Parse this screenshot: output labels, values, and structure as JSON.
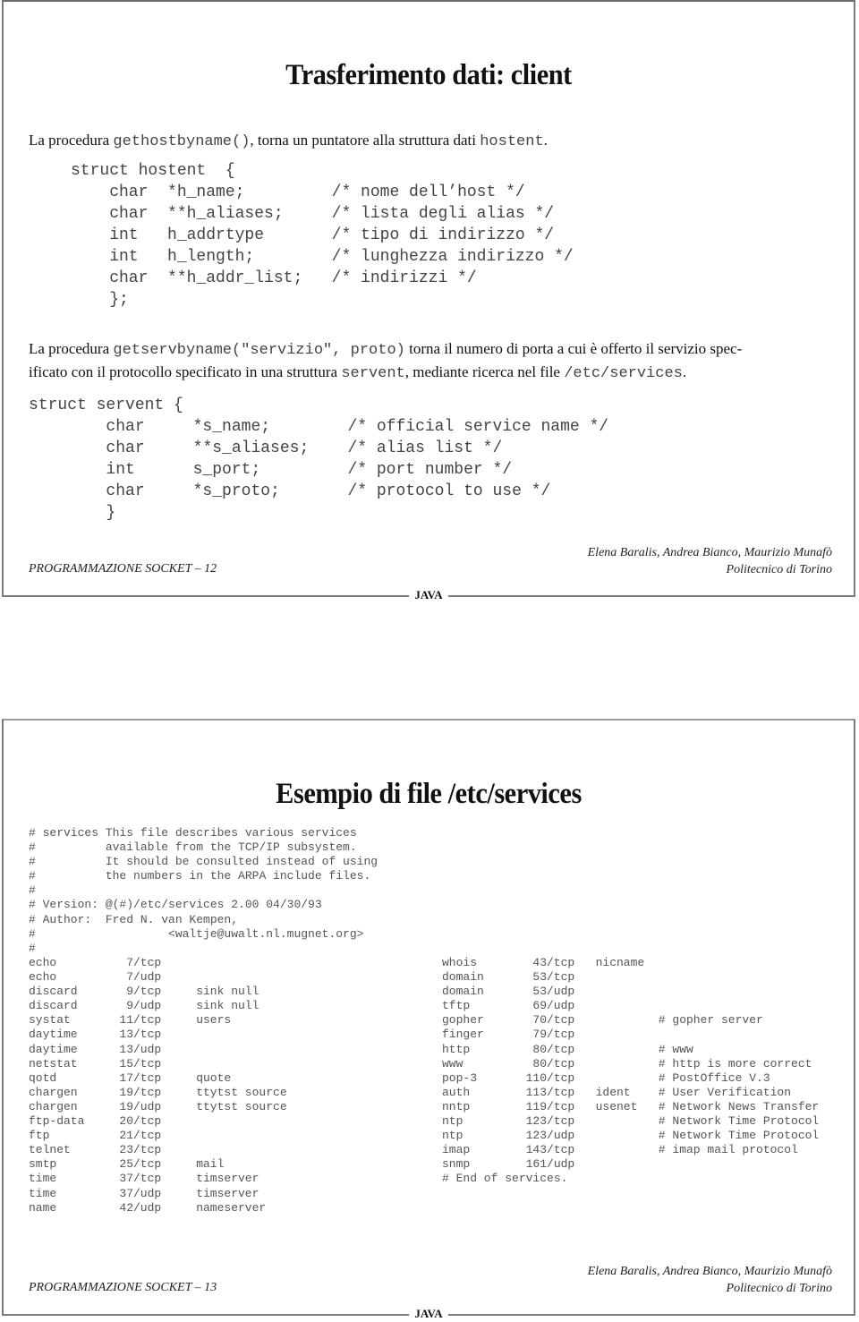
{
  "slides": [
    {
      "title": "Trasferimento dati: client",
      "intro": {
        "prefix": "La procedura ",
        "code1": "gethostbyname()",
        "middle": ", torna un puntatore alla struttura dati ",
        "code2": "hostent",
        "suffix": "."
      },
      "hostent_code": [
        "struct hostent  {",
        "    char  *h_name;         /* nome dell’host */",
        "    char  **h_aliases;     /* lista degli alias */",
        "    int   h_addrtype       /* tipo di indirizzo */",
        "    int   h_length;        /* lunghezza indirizzo */",
        "    char  **h_addr_list;   /* indirizzi */",
        "    };"
      ],
      "servby": {
        "prefix": "La procedura ",
        "code1": "getservbyname(\"servizio\", proto)",
        "line1_rest": " torna il numero di porta a cui è offerto il servizio spec-",
        "line2_prefix": "ificato con il protocollo specificato in una struttura ",
        "code2": "servent",
        "line2_middle": ", mediante ricerca nel file ",
        "code3": "/etc/services",
        "suffix": "."
      },
      "servent_code": [
        "struct servent {",
        "        char     *s_name;        /* official service name */",
        "        char     **s_aliases;    /* alias list */",
        "        int      s_port;         /* port number */",
        "        char     *s_proto;       /* protocol to use */",
        "        }"
      ],
      "footer": {
        "left": "PROGRAMMAZIONE SOCKET – 12",
        "authors": "Elena Baralis, Andrea Bianco, Maurizio Munafò",
        "institution": "Politecnico di Torino",
        "label": "JAVA"
      }
    },
    {
      "title": "Esempio di file /etc/services",
      "header_comments": [
        "# services This file describes various services",
        "#          available from the TCP/IP subsystem.",
        "#          It should be consulted instead of using",
        "#          the numbers in the ARPA include files.",
        "#",
        "# Version: @(#)/etc/services 2.00 04/30/93",
        "# Author:  Fred N. van Kempen,",
        "#                   <waltje@uwalt.nl.mugnet.org>",
        "#"
      ],
      "services_left": [
        {
          "name": "echo",
          "port": "7/tcp",
          "aliases": "",
          "comment": ""
        },
        {
          "name": "echo",
          "port": "7/udp",
          "aliases": "",
          "comment": ""
        },
        {
          "name": "discard",
          "port": "9/tcp",
          "aliases": "sink null",
          "comment": ""
        },
        {
          "name": "discard",
          "port": "9/udp",
          "aliases": "sink null",
          "comment": ""
        },
        {
          "name": "systat",
          "port": "11/tcp",
          "aliases": "users",
          "comment": ""
        },
        {
          "name": "daytime",
          "port": "13/tcp",
          "aliases": "",
          "comment": ""
        },
        {
          "name": "daytime",
          "port": "13/udp",
          "aliases": "",
          "comment": ""
        },
        {
          "name": "netstat",
          "port": "15/tcp",
          "aliases": "",
          "comment": ""
        },
        {
          "name": "qotd",
          "port": "17/tcp",
          "aliases": "quote",
          "comment": ""
        },
        {
          "name": "chargen",
          "port": "19/tcp",
          "aliases": "ttytst source",
          "comment": ""
        },
        {
          "name": "chargen",
          "port": "19/udp",
          "aliases": "ttytst source",
          "comment": ""
        },
        {
          "name": "ftp-data",
          "port": "20/tcp",
          "aliases": "",
          "comment": ""
        },
        {
          "name": "ftp",
          "port": "21/tcp",
          "aliases": "",
          "comment": ""
        },
        {
          "name": "telnet",
          "port": "23/tcp",
          "aliases": "",
          "comment": ""
        },
        {
          "name": "smtp",
          "port": "25/tcp",
          "aliases": "mail",
          "comment": ""
        },
        {
          "name": "time",
          "port": "37/tcp",
          "aliases": "timserver",
          "comment": ""
        },
        {
          "name": "time",
          "port": "37/udp",
          "aliases": "timserver",
          "comment": ""
        },
        {
          "name": "name",
          "port": "42/udp",
          "aliases": "nameserver",
          "comment": ""
        }
      ],
      "services_right": [
        {
          "name": "whois",
          "port": "43/tcp",
          "aliases": "nicname",
          "comment": ""
        },
        {
          "name": "domain",
          "port": "53/tcp",
          "aliases": "",
          "comment": ""
        },
        {
          "name": "domain",
          "port": "53/udp",
          "aliases": "",
          "comment": ""
        },
        {
          "name": "tftp",
          "port": "69/udp",
          "aliases": "",
          "comment": ""
        },
        {
          "name": "gopher",
          "port": "70/tcp",
          "aliases": "",
          "comment": "# gopher server"
        },
        {
          "name": "finger",
          "port": "79/tcp",
          "aliases": "",
          "comment": ""
        },
        {
          "name": "http",
          "port": "80/tcp",
          "aliases": "",
          "comment": "# www"
        },
        {
          "name": "www",
          "port": "80/tcp",
          "aliases": "",
          "comment": "# http is more correct"
        },
        {
          "name": "pop-3",
          "port": "110/tcp",
          "aliases": "",
          "comment": "# PostOffice V.3"
        },
        {
          "name": "auth",
          "port": "113/tcp",
          "aliases": "ident",
          "comment": "# User Verification"
        },
        {
          "name": "nntp",
          "port": "119/tcp",
          "aliases": "usenet",
          "comment": "# Network News Transfer"
        },
        {
          "name": "ntp",
          "port": "123/tcp",
          "aliases": "",
          "comment": "# Network Time Protocol"
        },
        {
          "name": "ntp",
          "port": "123/udp",
          "aliases": "",
          "comment": "# Network Time Protocol"
        },
        {
          "name": "imap",
          "port": "143/tcp",
          "aliases": "",
          "comment": "# imap mail protocol"
        },
        {
          "name": "snmp",
          "port": "161/udp",
          "aliases": "",
          "comment": ""
        }
      ],
      "end_line": "# End of services.",
      "footer": {
        "left": "PROGRAMMAZIONE SOCKET – 13",
        "authors": "Elena Baralis, Andrea Bianco, Maurizio Munafò",
        "institution": "Politecnico di Torino",
        "label": "JAVA"
      }
    }
  ]
}
